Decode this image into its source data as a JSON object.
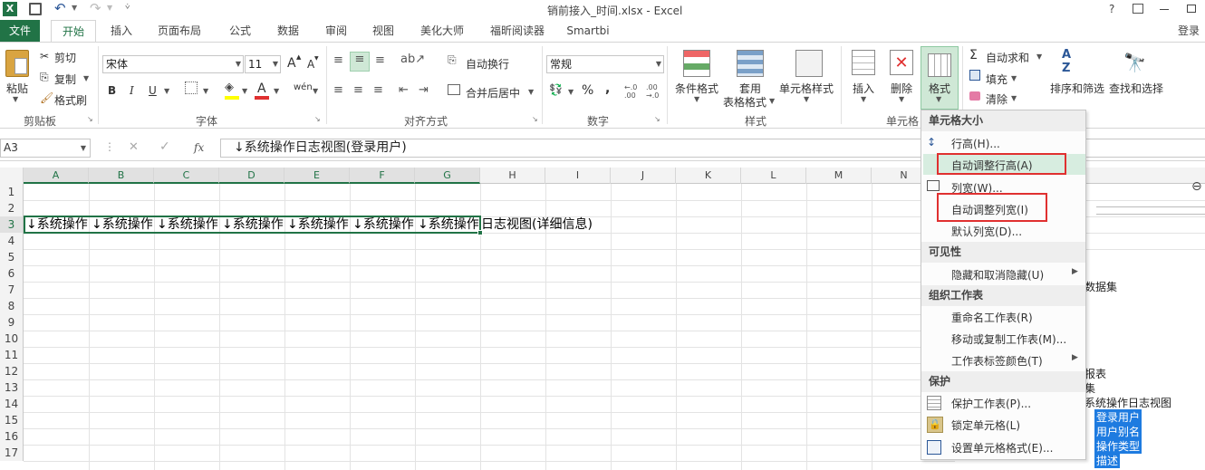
{
  "title_bar": {
    "title": "销前接入_时间.xlsx - Excel",
    "help": "?"
  },
  "tabs": {
    "file": "文件",
    "items": [
      "开始",
      "插入",
      "页面布局",
      "公式",
      "数据",
      "审阅",
      "视图",
      "美化大师",
      "福昕阅读器",
      "Smartbi"
    ],
    "login": "登录"
  },
  "clipboard": {
    "paste": "粘贴",
    "cut": "剪切",
    "copy": "复制",
    "painter": "格式刷",
    "group": "剪贴板"
  },
  "font": {
    "name": "宋体",
    "size": "11",
    "bold": "B",
    "italic": "I",
    "underline": "U",
    "grow": "A",
    "shrink": "A",
    "phonetic": "wén",
    "group": "字体"
  },
  "alignment": {
    "wrap": "自动换行",
    "merge": "合并后居中",
    "group": "对齐方式"
  },
  "number": {
    "format": "常规",
    "percent": "%",
    "comma": ",",
    "inc": "←.0\n.00",
    "dec": ".00\n→.0",
    "group": "数字"
  },
  "styles": {
    "conditional": "条件格式",
    "table_line1": "套用",
    "table_line2": "表格格式",
    "cell_style": "单元格样式",
    "group": "样式"
  },
  "cells": {
    "insert": "插入",
    "delete": "删除",
    "format": "格式",
    "group": "单元格"
  },
  "editing": {
    "autosum": "自动求和",
    "fill": "填充",
    "clear": "清除",
    "sort": "排序和筛选",
    "find": "查找和选择"
  },
  "formula_bar": {
    "name_box": "A3",
    "fx": "fx",
    "content": "↓系统操作日志视图(登录用户)"
  },
  "columns": [
    "A",
    "B",
    "C",
    "D",
    "E",
    "F",
    "G",
    "H",
    "I",
    "J",
    "K",
    "L",
    "M",
    "N"
  ],
  "rows": [
    "1",
    "2",
    "3",
    "4",
    "5",
    "6",
    "7",
    "8",
    "9",
    "10",
    "11",
    "12",
    "13",
    "14",
    "15",
    "16",
    "17"
  ],
  "row3_cells": [
    "↓系统操作",
    "↓系统操作",
    "↓系统操作",
    "↓系统操作",
    "↓系统操作",
    "↓系统操作",
    "↓系统操作"
  ],
  "row3_overflow": "日志视图(详细信息)",
  "format_menu": {
    "section_size": "单元格大小",
    "row_height": "行高(H)...",
    "autofit_row": "自动调整行高(A)",
    "col_width": "列宽(W)...",
    "autofit_col": "自动调整列宽(I)",
    "default_width": "默认列宽(D)...",
    "section_visibility": "可见性",
    "hide_unhide": "隐藏和取消隐藏(U)",
    "section_organize": "组织工作表",
    "rename": "重命名工作表(R)",
    "move_copy": "移动或复制工作表(M)...",
    "tab_color": "工作表标签颜色(T)",
    "section_protect": "保护",
    "protect_sheet": "保护工作表(P)...",
    "lock_cell": "锁定单元格(L)",
    "format_cells": "设置单元格格式(E)..."
  },
  "side_panel": {
    "text1": "数据集",
    "text2": "报表",
    "text3": "集",
    "text4": "系统操作日志视图",
    "fields": [
      "登录用户",
      "用户别名",
      "操作类型",
      "描述"
    ]
  },
  "colors": {
    "excel_green": "#217346",
    "red_box": "#e03030",
    "selection_blue": "#1e7be0"
  }
}
